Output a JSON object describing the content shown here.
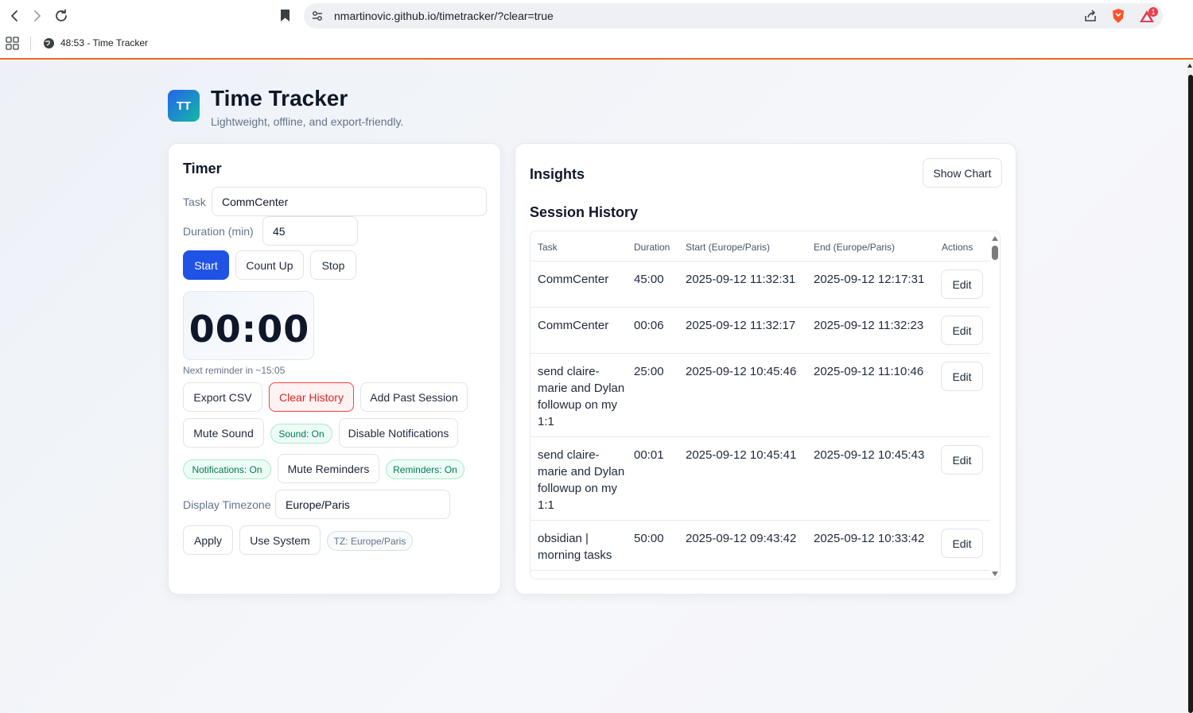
{
  "browser": {
    "url": "nmartinovic.github.io/timetracker/?clear=true",
    "tab_title": "48:53 - Time Tracker",
    "notification_count": "1"
  },
  "app": {
    "logo": "TT",
    "title": "Time Tracker",
    "subtitle": "Lightweight, offline, and export-friendly."
  },
  "timer": {
    "heading": "Timer",
    "task_label": "Task",
    "task_value": "CommCenter",
    "duration_label": "Duration (min)",
    "duration_value": "45",
    "start_label": "Start",
    "countup_label": "Count Up",
    "stop_label": "Stop",
    "display": "00:00",
    "reminder": "Next reminder in ~15:05",
    "export_label": "Export CSV",
    "clear_label": "Clear History",
    "add_past_label": "Add Past Session",
    "mute_sound_label": "Mute Sound",
    "sound_status": "Sound: On",
    "disable_notif_label": "Disable Notifications",
    "notif_status": "Notifications: On",
    "mute_reminders_label": "Mute Reminders",
    "reminders_status": "Reminders: On",
    "tz_label": "Display Timezone",
    "tz_value": "Europe/Paris",
    "apply_label": "Apply",
    "use_system_label": "Use System",
    "tz_status": "TZ: Europe/Paris"
  },
  "insights": {
    "heading": "Insights",
    "show_chart_label": "Show Chart",
    "history_heading": "Session History",
    "columns": [
      "Task",
      "Duration",
      "Start (Europe/Paris)",
      "End (Europe/Paris)",
      "Actions"
    ],
    "rows": [
      {
        "task": "CommCenter",
        "duration": "45:00",
        "start": "2025-09-12 11:32:31",
        "end": "2025-09-12 12:17:31",
        "action": "Edit"
      },
      {
        "task": "CommCenter",
        "duration": "00:06",
        "start": "2025-09-12 11:32:17",
        "end": "2025-09-12 11:32:23",
        "action": "Edit"
      },
      {
        "task": "send claire-marie and Dylan followup on my 1:1",
        "duration": "25:00",
        "start": "2025-09-12 10:45:46",
        "end": "2025-09-12 11:10:46",
        "action": "Edit"
      },
      {
        "task": "send claire-marie and Dylan followup on my 1:1",
        "duration": "00:01",
        "start": "2025-09-12 10:45:41",
        "end": "2025-09-12 10:45:43",
        "action": "Edit"
      },
      {
        "task": "obsidian | morning tasks",
        "duration": "50:00",
        "start": "2025-09-12 09:43:42",
        "end": "2025-09-12 10:33:42",
        "action": "Edit"
      }
    ]
  }
}
